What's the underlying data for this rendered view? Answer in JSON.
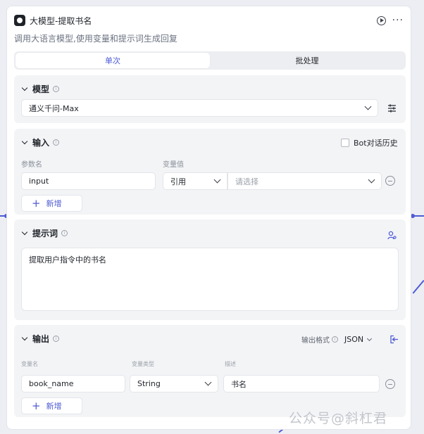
{
  "node": {
    "title": "大模型-提取书名",
    "subtitle": "调用大语言模型,使用变量和提示词生成回复",
    "more_label": "···"
  },
  "tabs": [
    {
      "label": "单次",
      "active": true
    },
    {
      "label": "批处理",
      "active": false
    }
  ],
  "model_section": {
    "title": "模型",
    "selected_model": "通义千问-Max"
  },
  "input_section": {
    "title": "输入",
    "history_label": "Bot对话历史",
    "col_param": "参数名",
    "col_value": "变量值",
    "rows": [
      {
        "name": "input",
        "mode": "引用",
        "value_placeholder": "请选择"
      }
    ],
    "add_label": "新增"
  },
  "prompt_section": {
    "title": "提示词",
    "text": "提取用户指令中的书名"
  },
  "output_section": {
    "title": "输出",
    "format_label": "输出格式",
    "format_value": "JSON",
    "col_name": "变量名",
    "col_type": "变量类型",
    "col_desc": "描述",
    "rows": [
      {
        "name": "book_name",
        "type": "String",
        "desc": "书名"
      }
    ],
    "add_label": "新增"
  },
  "watermark": "公众号@斜杠君",
  "colors": {
    "accent": "#4e5bd4",
    "section_bg": "#f3f4f6"
  },
  "icons": [
    "app-logo-icon",
    "run-icon",
    "more-icon",
    "chevron-down-icon",
    "info-icon",
    "settings-sliders-icon",
    "minus-circle-icon",
    "plus-icon",
    "prompt-user-icon",
    "export-icon"
  ]
}
